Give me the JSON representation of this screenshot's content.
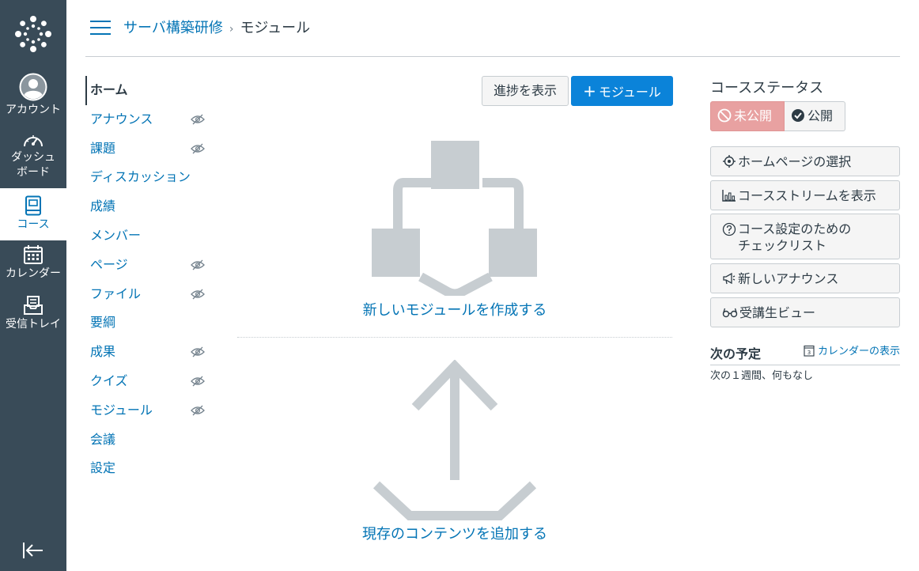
{
  "global_nav": {
    "account": "アカウント",
    "dashboard_line1": "ダッシュ",
    "dashboard_line2": "ボード",
    "courses": "コース",
    "calendar": "カレンダー",
    "inbox": "受信トレイ"
  },
  "breadcrumb": {
    "course": "サーバ構築研修",
    "separator": "›",
    "current": "モジュール"
  },
  "course_nav": [
    {
      "label": "ホーム",
      "active": true,
      "hidden": false
    },
    {
      "label": "アナウンス",
      "active": false,
      "hidden": true
    },
    {
      "label": "課題",
      "active": false,
      "hidden": true
    },
    {
      "label": "ディスカッション",
      "active": false,
      "hidden": false
    },
    {
      "label": "成績",
      "active": false,
      "hidden": false
    },
    {
      "label": "メンバー",
      "active": false,
      "hidden": false
    },
    {
      "label": "ページ",
      "active": false,
      "hidden": true
    },
    {
      "label": "ファイル",
      "active": false,
      "hidden": true
    },
    {
      "label": "要綱",
      "active": false,
      "hidden": false
    },
    {
      "label": "成果",
      "active": false,
      "hidden": true
    },
    {
      "label": "クイズ",
      "active": false,
      "hidden": true
    },
    {
      "label": "モジュール",
      "active": false,
      "hidden": true
    },
    {
      "label": "会議",
      "active": false,
      "hidden": false
    },
    {
      "label": "設定",
      "active": false,
      "hidden": false
    }
  ],
  "main": {
    "view_progress": "進捗を表示",
    "add_module": "モジュール",
    "add_module_symbol": "+",
    "create_module": "新しいモジュールを作成する",
    "add_existing": "現存のコンテンツを追加する"
  },
  "sidebar": {
    "course_status": "コースステータス",
    "unpublished": "未公開",
    "published": "公開",
    "buttons": [
      {
        "label": "ホームページの選択",
        "icon": "target-icon"
      },
      {
        "label": "コースストリームを表示",
        "icon": "stream-chart-icon"
      },
      {
        "label": "コース設定のための\nチェックリスト",
        "icon": "question-icon"
      },
      {
        "label": "新しいアナウンス",
        "icon": "megaphone-icon"
      },
      {
        "label": "受講生ビュー",
        "icon": "glasses-icon"
      }
    ],
    "todo_title": "次の予定",
    "calendar_link": "カレンダーの表示",
    "calendar_day": "3",
    "todo_empty": "次の１週間、何もなし"
  },
  "colors": {
    "nav_bg": "#394b58",
    "link": "#0374b5",
    "primary": "#0b83d9",
    "unpublished": "#e8a1a1",
    "illustration": "#c7cdd1"
  }
}
